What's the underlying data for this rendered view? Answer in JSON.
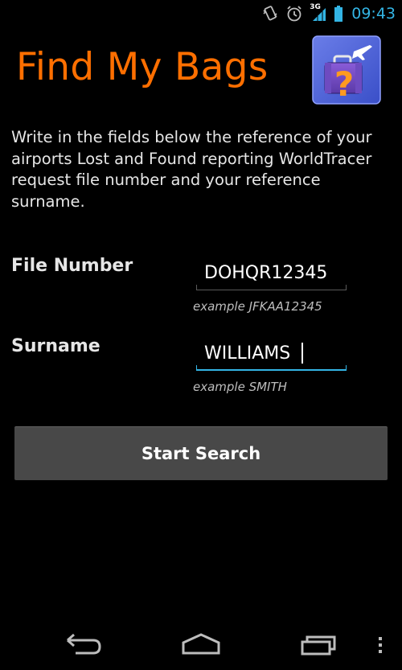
{
  "status_bar": {
    "network_label": "3G",
    "time": "09:43",
    "icons": [
      "vibrate-icon",
      "alarm-icon",
      "signal-icon",
      "battery-icon"
    ]
  },
  "header": {
    "title": "Find My Bags",
    "icon": "luggage-question-icon"
  },
  "intro": {
    "text": "Write in the fields below the reference of your airports Lost and Found reporting WorldTracer request file number and your reference surname."
  },
  "form": {
    "file_number": {
      "label": "File Number",
      "value": "DOHQR12345",
      "example": "example JFKAA12345"
    },
    "surname": {
      "label": "Surname",
      "value": "WILLIAMS",
      "example": "example SMITH"
    },
    "submit_label": "Start Search"
  },
  "colors": {
    "title": "#ff6f00",
    "accent": "#33b5e5",
    "button": "#484848",
    "background": "#000000"
  },
  "nav_bar": {
    "icons": [
      "back-icon",
      "home-icon",
      "recent-apps-icon",
      "menu-icon"
    ]
  }
}
